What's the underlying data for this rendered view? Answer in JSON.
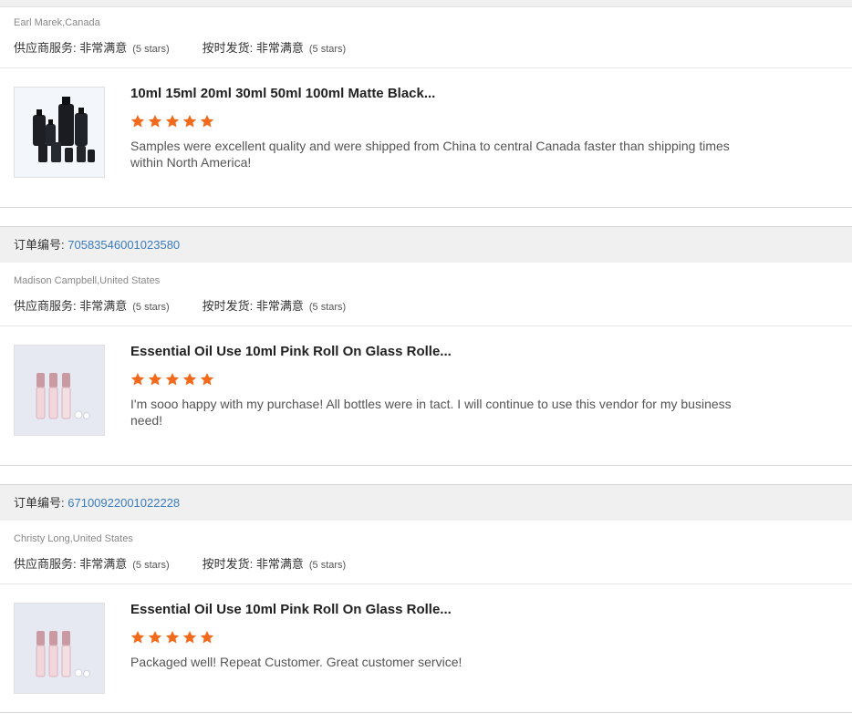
{
  "labels": {
    "order_prefix": "订单编号:",
    "supplier_service": "供应商服务:",
    "on_time_delivery": "按时发货:",
    "very_satisfied": "非常满意",
    "stars_text": "(5 stars)"
  },
  "colors": {
    "star": "#f26a1b",
    "order_link": "#3a7bbf"
  },
  "reviews": [
    {
      "order_no": "",
      "reviewer": "Earl Marek,Canada",
      "supplier_rating": 5,
      "delivery_rating": 5,
      "product_title": "10ml 15ml 20ml 30ml 50ml 100ml Matte Black...",
      "product_image": "black-matte-bottles",
      "stars": 5,
      "text": "Samples were excellent quality and were shipped from China to central Canada faster than shipping times within North America!"
    },
    {
      "order_no": "70583546001023580",
      "reviewer": "Madison Campbell,United States",
      "supplier_rating": 5,
      "delivery_rating": 5,
      "product_title": "Essential Oil Use 10ml Pink Roll On Glass Rolle...",
      "product_image": "pink-roll-on-bottles",
      "stars": 5,
      "text": "I'm sooo happy with my purchase! All bottles were in tact. I will continue to use this vendor for my business need!"
    },
    {
      "order_no": "67100922001022228",
      "reviewer": "Christy Long,United States",
      "supplier_rating": 5,
      "delivery_rating": 5,
      "product_title": "Essential Oil Use 10ml Pink Roll On Glass Rolle...",
      "product_image": "pink-roll-on-bottles",
      "stars": 5,
      "text": "Packaged well! Repeat Customer. Great customer service!"
    }
  ]
}
